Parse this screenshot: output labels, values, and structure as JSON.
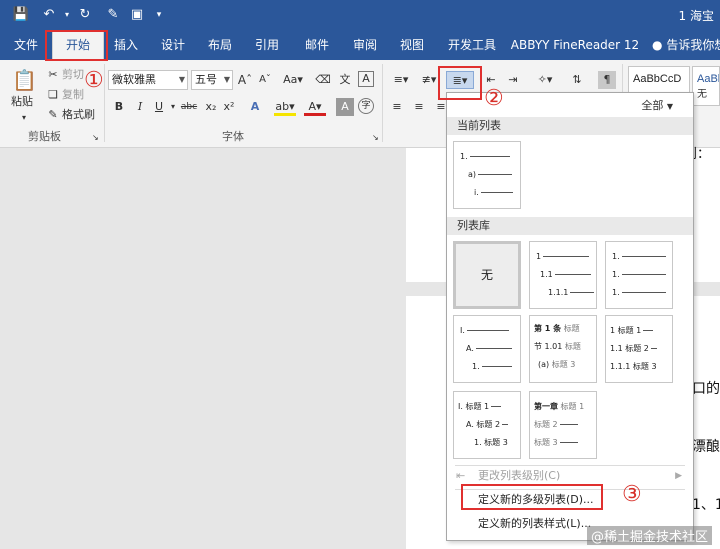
{
  "title_bar": {
    "doc_title": "1 海宝"
  },
  "tabs": [
    "文件",
    "开始",
    "插入",
    "设计",
    "布局",
    "引用",
    "邮件",
    "审阅",
    "视图",
    "开发工具",
    "ABBYY FineReader 12"
  ],
  "tell_me": "告诉我你想",
  "clipboard": {
    "paste": "粘贴",
    "cut": "剪切",
    "copy": "复制",
    "format_painter": "格式刷",
    "group_label": "剪贴板"
  },
  "font": {
    "name": "微软雅黑",
    "size": "五号",
    "group_label": "字体"
  },
  "styles": {
    "style1": "AaBbCcD",
    "style2": "AaBb",
    "style2_sub": "无"
  },
  "annotations": {
    "one": "①",
    "two": "②",
    "three": "③"
  },
  "document": {
    "text_top": "则：",
    "line1": "口的",
    "line2": "漂酿",
    "line3": "1、1"
  },
  "dropdown": {
    "filter": "全部",
    "current_header": "当前列表",
    "library_header": "列表库",
    "none_label": "无",
    "tile_current": [
      "1.",
      "a)",
      "i."
    ],
    "tile_b": [
      "1",
      "1.1",
      "1.1.1"
    ],
    "tile_c": [
      "1.",
      "1.",
      "1."
    ],
    "tile_d": [
      "I.",
      "A.",
      "1."
    ],
    "tile_e": [
      "第 1 条",
      "标题",
      "节 1.01",
      "标题",
      "(a)",
      "标题 3"
    ],
    "tile_f": [
      "1 标题 1",
      "1.1 标题 2",
      "1.1.1 标题 3"
    ],
    "tile_g": [
      "I. 标题 1",
      "A. 标题 2",
      "1. 标题 3"
    ],
    "tile_h": [
      "第一章",
      "标题 1",
      "标题 2",
      "标题 3"
    ],
    "change_level": "更改列表级别(C)",
    "define_new_multilevel": "定义新的多级列表(D)...",
    "define_new_style": "定义新的列表样式(L)..."
  },
  "watermark": "@稀土掘金技术社区"
}
